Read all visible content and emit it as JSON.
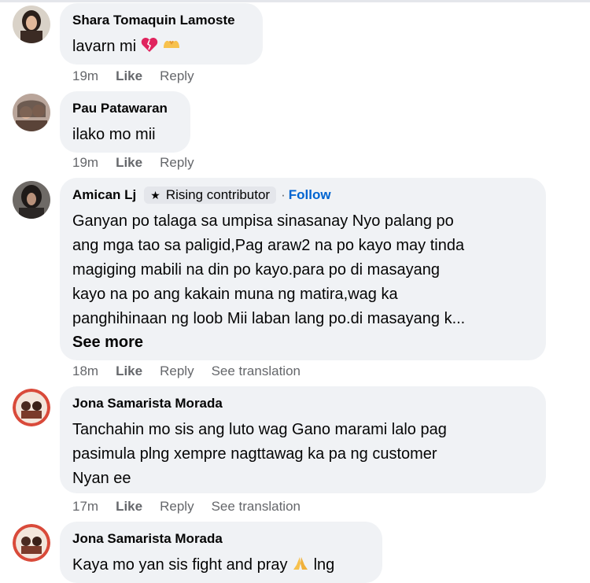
{
  "comments": [
    {
      "author": "Shara Tomaquin Lamoste",
      "text": "lavarn mi",
      "emojis": [
        "broken-heart-emoji",
        "heart-hands-emoji"
      ],
      "time": "19m",
      "like": "Like",
      "reply": "Reply"
    },
    {
      "author": "Pau Patawaran",
      "text": "ilako mo mii",
      "time": "19m",
      "like": "Like",
      "reply": "Reply"
    },
    {
      "author": "Amican Lj",
      "badge": "Rising contributor",
      "follow": "Follow",
      "lines": [
        "Ganyan po talaga sa umpisa sinasanay Nyo palang po",
        "ang mga tao sa paligid,Pag araw2 na po kayo may tinda",
        "magiging mabili na din po kayo.para po di masayang",
        "kayo na po ang kakain muna ng matira,wag ka",
        "panghihinaan ng loob Mii laban lang po.di masayang k..."
      ],
      "see_more": "See more",
      "time": "18m",
      "like": "Like",
      "reply": "Reply",
      "translate": "See translation"
    },
    {
      "author": "Jona Samarista Morada",
      "lines": [
        "Tanchahin mo sis ang luto wag Gano marami lalo pag",
        "pasimula plng xempre nagttawag ka pa ng customer",
        "Nyan ee"
      ],
      "time": "17m",
      "like": "Like",
      "reply": "Reply",
      "translate": "See translation"
    },
    {
      "author": "Jona Samarista Morada",
      "text": "Kaya mo yan sis fight and pray",
      "text_after": "lng",
      "emojis": [
        "folded-hands-emoji"
      ]
    }
  ],
  "colors": {
    "bubble": "#f0f2f5",
    "muted": "#65676b",
    "link": "#0064d1"
  }
}
